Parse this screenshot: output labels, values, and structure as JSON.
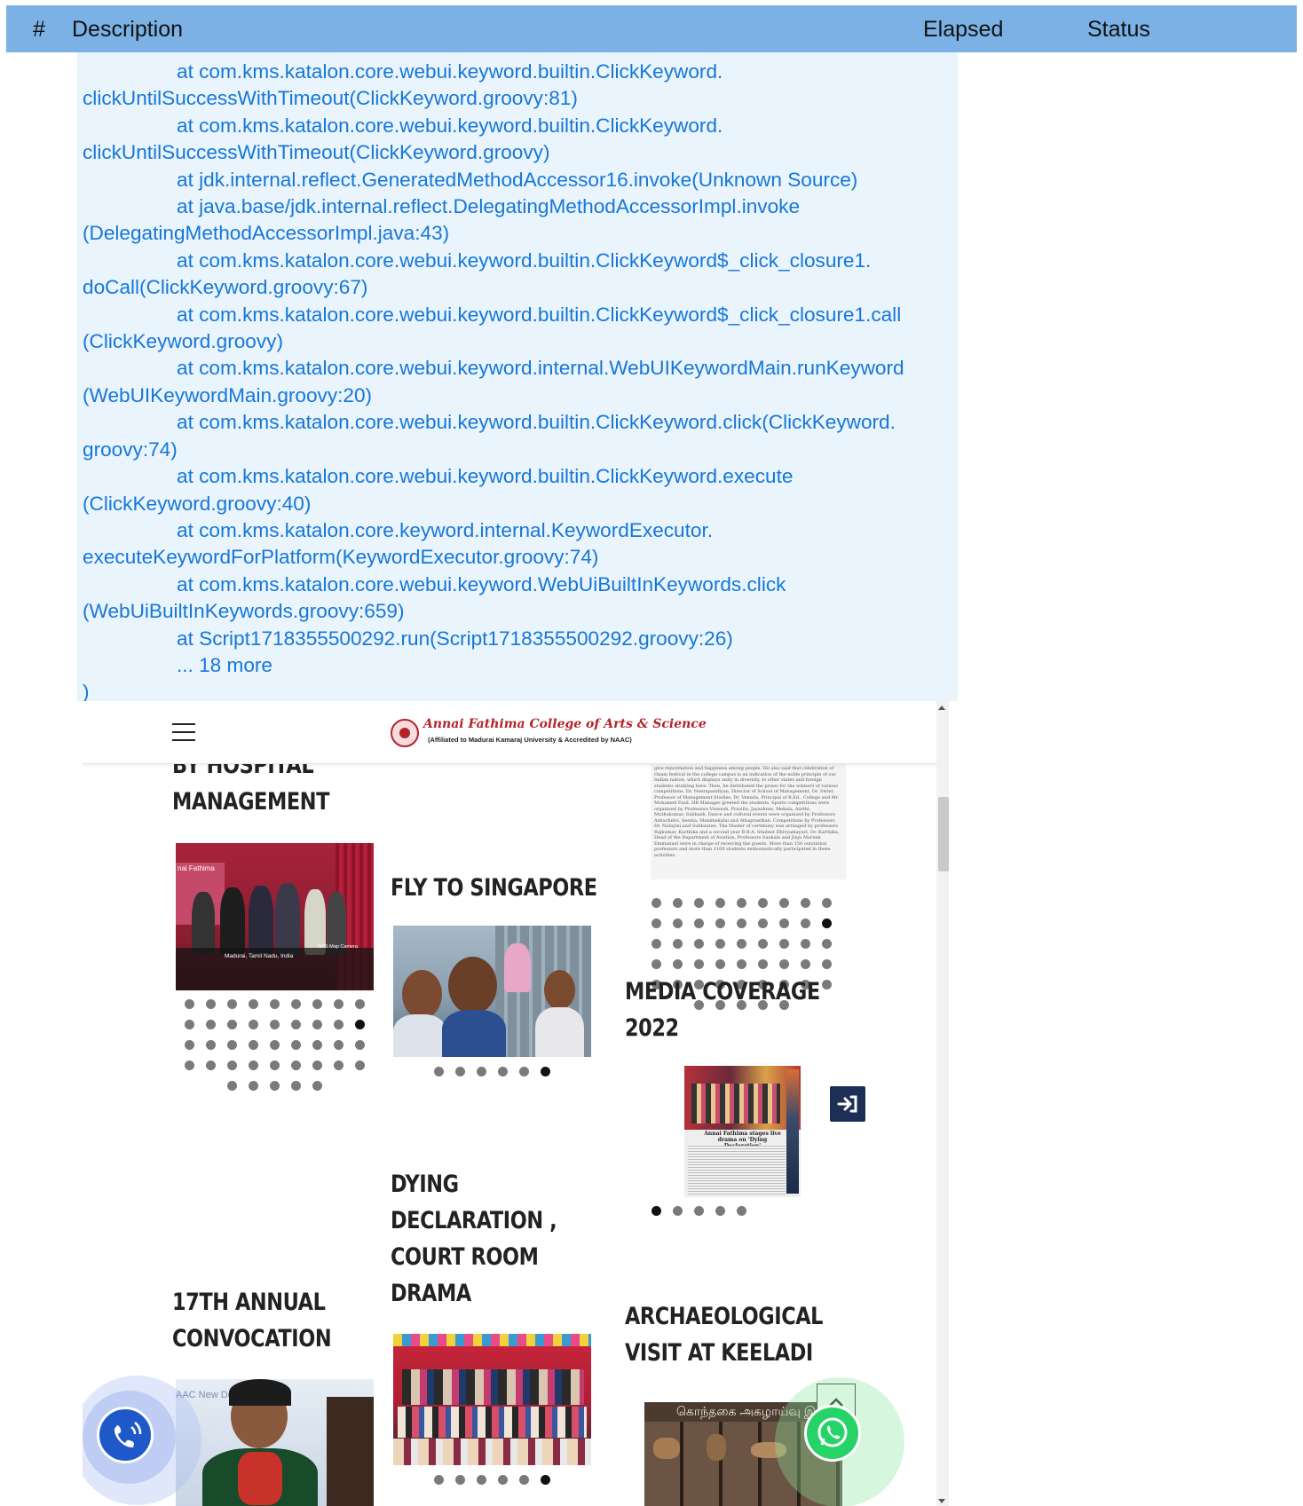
{
  "table_header": {
    "index": "#",
    "description": "Description",
    "elapsed": "Elapsed",
    "status": "Status"
  },
  "trace": {
    "lines": [
      {
        "indent": true,
        "text": "at com.kms.katalon.core.webui.keyword.builtin.ClickKeyword."
      },
      {
        "indent": false,
        "text": "clickUntilSuccessWithTimeout(ClickKeyword.groovy:81)"
      },
      {
        "indent": true,
        "text": "at com.kms.katalon.core.webui.keyword.builtin.ClickKeyword."
      },
      {
        "indent": false,
        "text": "clickUntilSuccessWithTimeout(ClickKeyword.groovy)"
      },
      {
        "indent": true,
        "text": "at jdk.internal.reflect.GeneratedMethodAccessor16.invoke(Unknown Source)"
      },
      {
        "indent": true,
        "text": "at java.base/jdk.internal.reflect.DelegatingMethodAccessorImpl.invoke"
      },
      {
        "indent": false,
        "text": "(DelegatingMethodAccessorImpl.java:43)"
      },
      {
        "indent": true,
        "text": "at com.kms.katalon.core.webui.keyword.builtin.ClickKeyword$_click_closure1."
      },
      {
        "indent": false,
        "text": "doCall(ClickKeyword.groovy:67)"
      },
      {
        "indent": true,
        "text": "at com.kms.katalon.core.webui.keyword.builtin.ClickKeyword$_click_closure1.call"
      },
      {
        "indent": false,
        "text": "(ClickKeyword.groovy)"
      },
      {
        "indent": true,
        "text": "at com.kms.katalon.core.webui.keyword.internal.WebUIKeywordMain.runKeyword"
      },
      {
        "indent": false,
        "text": "(WebUIKeywordMain.groovy:20)"
      },
      {
        "indent": true,
        "text": "at com.kms.katalon.core.webui.keyword.builtin.ClickKeyword.click(ClickKeyword."
      },
      {
        "indent": false,
        "text": "groovy:74)"
      },
      {
        "indent": true,
        "text": "at com.kms.katalon.core.webui.keyword.builtin.ClickKeyword.execute"
      },
      {
        "indent": false,
        "text": "(ClickKeyword.groovy:40)"
      },
      {
        "indent": true,
        "text": "at com.kms.katalon.core.keyword.internal.KeywordExecutor."
      },
      {
        "indent": false,
        "text": "executeKeywordForPlatform(KeywordExecutor.groovy:74)"
      },
      {
        "indent": true,
        "text": "at com.kms.katalon.core.webui.keyword.WebUiBuiltInKeywords.click"
      },
      {
        "indent": false,
        "text": "(WebUiBuiltInKeywords.groovy:659)"
      },
      {
        "indent": true,
        "text": "at Script1718355500292.run(Script1718355500292.groovy:26)"
      },
      {
        "indent": true,
        "text": "... 18 more"
      },
      {
        "indent": false,
        "text": ")"
      }
    ]
  },
  "site": {
    "logo_title": "Annai Fathima College of Arts & Science",
    "logo_subtitle": "(Affiliated to Madurai Kamaraj University & Accredited by NAAC)",
    "headings": {
      "hospital_1": "BY HOSPITAL",
      "hospital_2": "MANAGEMENT",
      "singapore": "FLY TO SINGAPORE",
      "media_1": "MEDIA COVERAGE",
      "media_2": "2022",
      "dying_1": "DYING",
      "dying_2": "DECLARATION ,",
      "dying_3": "COURT ROOM",
      "dying_4": "DRAMA",
      "conv_1": "17TH ANNUAL",
      "conv_2": "CONVOCATION",
      "arch_1": "ARCHAEOLOGICAL",
      "arch_2": "VISIT AT KEELADI"
    },
    "photo_texts": {
      "gps_label": "GPS Map Camera",
      "gps_place": "Madurai, Tamil Nadu, India",
      "banner": "nai Fathima",
      "news_caption": "Annai Fathima stages live drama on 'Dying Declaration'",
      "keeladi_banner": "கொந்தகை அகழாய்வு இ",
      "conv_banner": "AAC New Del"
    },
    "news_article": "give rejuvenation and happiness among people. He also said that celebration of Onam festival in the college campus is an indication of the noble principle of our Indian nation, which displays unity in diversity, to other states and foreign students studying here. Then, he distributed the prizes for the winners of various competitions. Dr. Neerapandiyan, Director of School of Management, Dr. Sister, Professor of Management Studies, Dr. Vennila, Principal of B.Ed., College and Mr. Mohamed Fazil, HR Manager greeted the students. Sports competitions were organised by Professors Viswesh, Pravilla, Jayashree, Mekala, Aarthi, Muthukumar, Subhash. Dance and cultural events were organised by Professors Azhuchelvi, Seema, Manimekalai and Athaprasthan. Competitions by Professors Dr. Nalayini and Subhasree. The Master of ceremony was arranged by professors Rajkumar, Karthika and a second year B.B.A. Student Dhivyamayuri. Dr. Karthika, Head of the Department of Aviation, Professors Saukala and Jinju Mariam Emmanuel were in charge of receiving the guests. More than 150 outstation professors and more than 1100 students enthusiastically participated in these activities.",
    "carousels": {
      "hospital": {
        "rows": [
          9,
          9,
          9,
          9,
          5
        ],
        "active_row": 1,
        "active_col": 8
      },
      "media_top": {
        "rows": [
          9,
          9,
          9,
          9,
          9,
          5
        ],
        "active_row": 1,
        "active_col": 8
      },
      "singapore": {
        "rows": [
          6
        ],
        "active_row": 0,
        "active_col": 5
      },
      "media_bottom": {
        "rows": [
          5
        ],
        "active_row": 0,
        "active_col": 0
      },
      "dying": {
        "rows": [
          6
        ],
        "active_row": 0,
        "active_col": 5
      }
    },
    "colors": {
      "header_bg": "#7bb1e4",
      "trace_bg": "#e9f4fd",
      "trace_text": "#1677d7",
      "login_btn": "#1e2f56",
      "logo_red": "#b3232a"
    }
  }
}
